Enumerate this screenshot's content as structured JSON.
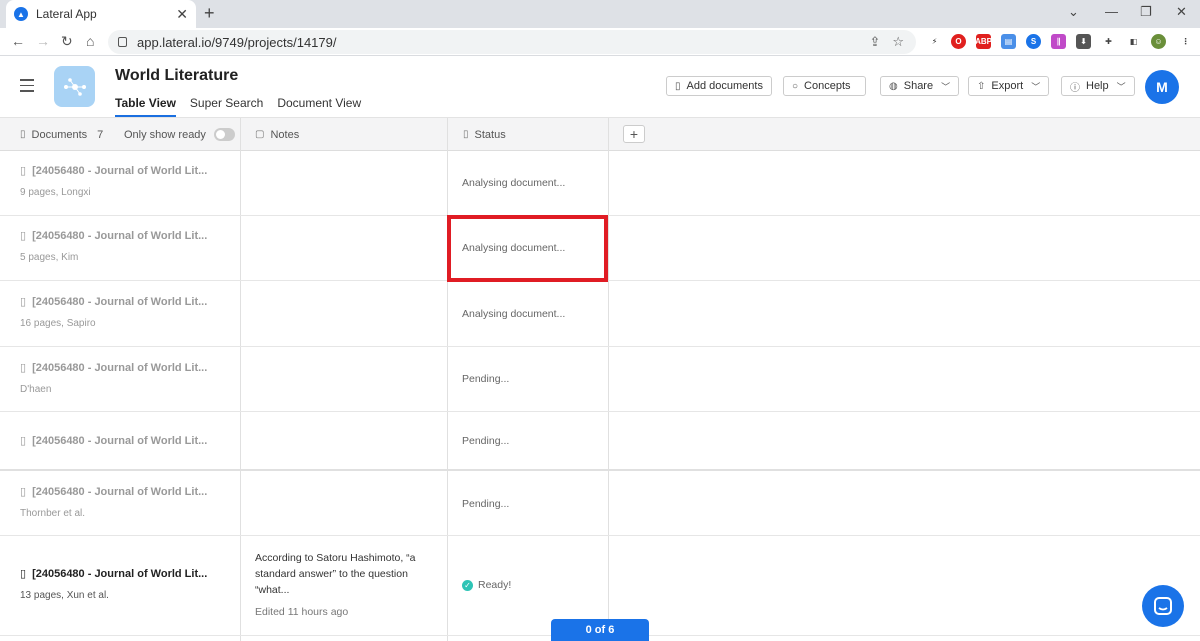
{
  "browser": {
    "tab_title": "Lateral App",
    "url": "app.lateral.io/9749/projects/14179/"
  },
  "header": {
    "project_title": "World Literature",
    "view_tabs": [
      "Table View",
      "Super Search",
      "Document View"
    ],
    "buttons": {
      "add_documents": "Add documents",
      "concepts": "Concepts",
      "share": "Share",
      "export": "Export",
      "help": "Help"
    },
    "avatar_initial": "M"
  },
  "table": {
    "col_documents": "Documents",
    "documents_count": "7",
    "only_show_ready": "Only show ready",
    "col_notes": "Notes",
    "col_status": "Status",
    "rows": [
      {
        "title": "[24056480 - Journal of World Lit...",
        "meta": "9 pages, Longxi",
        "status": "Analysing document...",
        "notes": "",
        "edited": ""
      },
      {
        "title": "[24056480 - Journal of World Lit...",
        "meta": "5 pages, Kim",
        "status": "Analysing document...",
        "notes": "",
        "edited": ""
      },
      {
        "title": "[24056480 - Journal of World Lit...",
        "meta": "16 pages, Sapiro",
        "status": "Analysing document...",
        "notes": "",
        "edited": ""
      },
      {
        "title": "[24056480 - Journal of World Lit...",
        "meta": "D'haen",
        "status": "Pending...",
        "notes": "",
        "edited": ""
      },
      {
        "title": "[24056480 - Journal of World Lit...",
        "meta": "",
        "status": "Pending...",
        "notes": "",
        "edited": ""
      },
      {
        "title": "[24056480 - Journal of World Lit...",
        "meta": "Thornber et al.",
        "status": "Pending...",
        "notes": "",
        "edited": ""
      },
      {
        "title": "[24056480 - Journal of World Lit...",
        "meta": "13 pages, Xun et al.",
        "status": "Ready!",
        "notes": "According to Satoru Hashimoto, “a standard answer” to the question “what...",
        "edited": "Edited 11 hours ago"
      }
    ]
  },
  "pager": "0 of 6",
  "colors": {
    "accent": "#1a73e8",
    "highlight": "#e01c24",
    "ready": "#2ec4b6"
  }
}
